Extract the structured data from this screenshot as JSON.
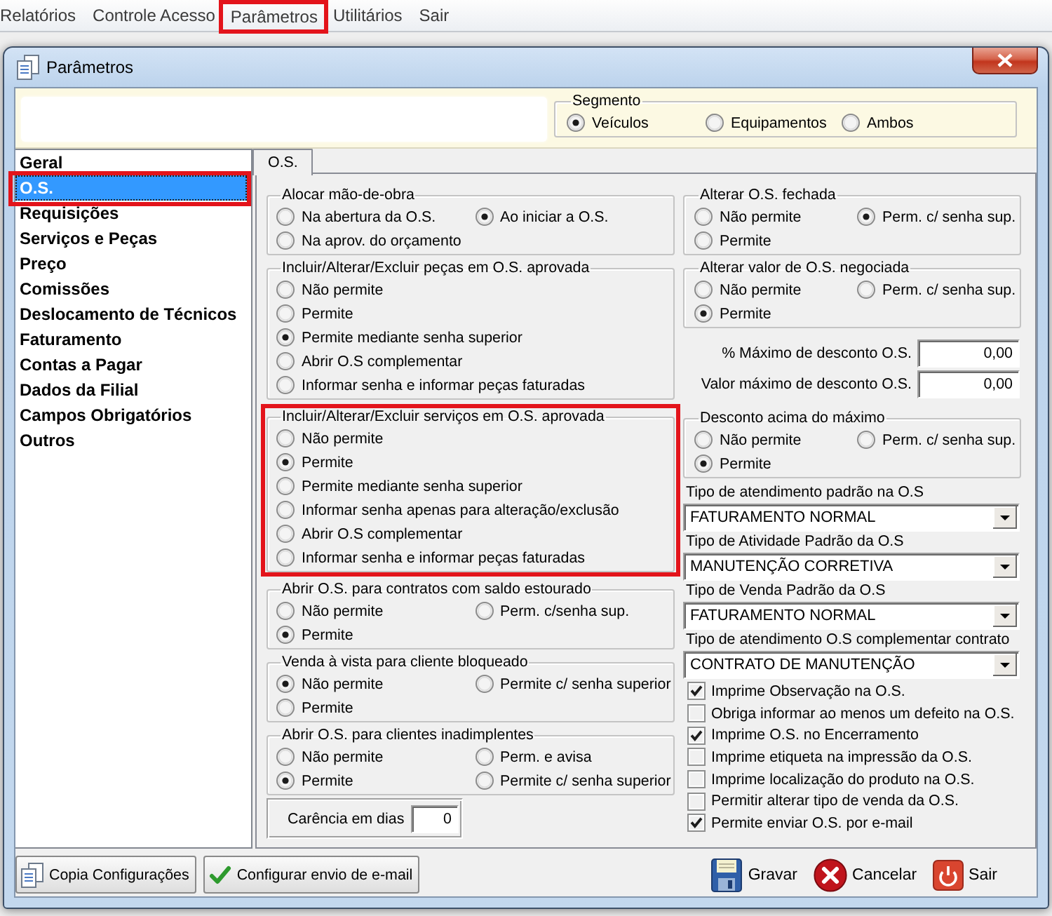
{
  "menu_bar": {
    "items": [
      {
        "label": "Relatórios",
        "highlighted": false
      },
      {
        "label": "Controle Acesso",
        "highlighted": false
      },
      {
        "label": "Parâmetros",
        "highlighted": true
      },
      {
        "label": "Utilitários",
        "highlighted": false
      },
      {
        "label": "Sair",
        "highlighted": false
      }
    ]
  },
  "window": {
    "title": "Parâmetros"
  },
  "segment": {
    "kind": "radio_row",
    "title": "Segmento",
    "options": [
      {
        "label": "Veículos",
        "selected": true
      },
      {
        "label": "Equipamentos",
        "selected": false
      },
      {
        "label": "Ambos",
        "selected": false
      }
    ]
  },
  "sidebar": {
    "items": [
      {
        "label": "Geral",
        "selected": false,
        "highlighted": false
      },
      {
        "label": "O.S.",
        "selected": true,
        "highlighted": true
      },
      {
        "label": "Requisições",
        "selected": false,
        "highlighted": false
      },
      {
        "label": "Serviços e Peças",
        "selected": false,
        "highlighted": false
      },
      {
        "label": "Preço",
        "selected": false,
        "highlighted": false
      },
      {
        "label": "Comissões",
        "selected": false,
        "highlighted": false
      },
      {
        "label": "Deslocamento de Técnicos",
        "selected": false,
        "highlighted": false
      },
      {
        "label": "Faturamento",
        "selected": false,
        "highlighted": false
      },
      {
        "label": "Contas a Pagar",
        "selected": false,
        "highlighted": false
      },
      {
        "label": "Dados da Filial",
        "selected": false,
        "highlighted": false
      },
      {
        "label": "Campos Obrigatórios",
        "selected": false,
        "highlighted": false
      },
      {
        "label": "Outros",
        "selected": false,
        "highlighted": false
      }
    ]
  },
  "tabs": [
    {
      "label": "O.S.",
      "selected": true
    }
  ],
  "left_column": [
    {
      "kind": "radio_grid",
      "title": "Alocar mão-de-obra",
      "highlighted": false,
      "options": [
        {
          "label": "Na abertura da O.S.",
          "selected": false
        },
        {
          "label": "Ao iniciar a O.S.",
          "selected": true
        },
        {
          "label": "Na aprov. do orçamento",
          "selected": false
        }
      ]
    },
    {
      "kind": "radio_list",
      "title": "Incluir/Alterar/Excluir peças em O.S. aprovada",
      "highlighted": false,
      "options": [
        {
          "label": "Não permite",
          "selected": false
        },
        {
          "label": "Permite",
          "selected": false
        },
        {
          "label": "Permite mediante senha superior",
          "selected": true
        },
        {
          "label": "Abrir O.S complementar",
          "selected": false
        },
        {
          "label": "Informar senha e informar peças faturadas",
          "selected": false
        }
      ]
    },
    {
      "kind": "radio_list",
      "title": "Incluir/Alterar/Excluir serviços em O.S. aprovada",
      "highlighted": true,
      "options": [
        {
          "label": "Não permite",
          "selected": false
        },
        {
          "label": "Permite",
          "selected": true
        },
        {
          "label": "Permite mediante senha superior",
          "selected": false
        },
        {
          "label": "Informar senha apenas para alteração/exclusão",
          "selected": false
        },
        {
          "label": "Abrir O.S complementar",
          "selected": false
        },
        {
          "label": "Informar senha e informar peças faturadas",
          "selected": false
        }
      ]
    },
    {
      "kind": "radio_grid",
      "title": "Abrir O.S. para contratos com saldo estourado",
      "highlighted": false,
      "options": [
        {
          "label": "Não permite",
          "selected": false
        },
        {
          "label": "Perm. c/senha sup.",
          "selected": false
        },
        {
          "label": "Permite",
          "selected": true
        }
      ]
    },
    {
      "kind": "radio_grid",
      "title": "Venda à vista para cliente bloqueado",
      "highlighted": false,
      "options": [
        {
          "label": "Não permite",
          "selected": true
        },
        {
          "label": "Permite c/ senha superior",
          "selected": false
        },
        {
          "label": "Permite",
          "selected": false
        }
      ]
    },
    {
      "kind": "radio_grid",
      "title": "Abrir O.S. para clientes inadimplentes",
      "highlighted": false,
      "options": [
        {
          "label": "Não permite",
          "selected": false
        },
        {
          "label": "Perm. e avisa",
          "selected": false
        },
        {
          "label": "Permite",
          "selected": true
        },
        {
          "label": "Permite c/ senha superior",
          "selected": false
        }
      ]
    },
    {
      "kind": "boxed_field",
      "label": "Carência em dias",
      "value": "0"
    }
  ],
  "right_column": [
    {
      "kind": "radio_grid",
      "title": "Alterar O.S. fechada",
      "highlighted": false,
      "options": [
        {
          "label": "Não permite",
          "selected": false
        },
        {
          "label": "Perm. c/ senha sup.",
          "selected": true
        },
        {
          "label": "Permite",
          "selected": false
        }
      ]
    },
    {
      "kind": "radio_grid",
      "title": "Alterar valor de O.S. negociada",
      "highlighted": false,
      "options": [
        {
          "label": "Não permite",
          "selected": false
        },
        {
          "label": "Perm. c/ senha sup.",
          "selected": false
        },
        {
          "label": "Permite",
          "selected": true
        }
      ]
    },
    {
      "kind": "number_field",
      "label": "% Máximo de desconto O.S.",
      "value": "0,00"
    },
    {
      "kind": "number_field",
      "label": "Valor máximo de desconto O.S.",
      "value": "0,00"
    },
    {
      "kind": "radio_grid",
      "title": "Desconto acima do máximo",
      "highlighted": false,
      "options": [
        {
          "label": "Não permite",
          "selected": false
        },
        {
          "label": "Perm. c/ senha sup.",
          "selected": false
        },
        {
          "label": "Permite",
          "selected": true
        }
      ]
    },
    {
      "kind": "dropdown",
      "label": "Tipo de atendimento padrão na O.S",
      "value": "FATURAMENTO NORMAL"
    },
    {
      "kind": "dropdown",
      "label": "Tipo de Atividade Padrão da O.S",
      "value": "MANUTENÇÃO CORRETIVA"
    },
    {
      "kind": "dropdown",
      "label": "Tipo de Venda Padrão da O.S",
      "value": "FATURAMENTO NORMAL"
    },
    {
      "kind": "dropdown",
      "label": "Tipo de atendimento O.S complementar contrato",
      "value": "CONTRATO DE MANUTENÇÃO"
    },
    {
      "kind": "checkbox",
      "label": "Imprime Observação na O.S.",
      "checked": true
    },
    {
      "kind": "checkbox",
      "label": "Obriga informar ao menos um defeito na O.S.",
      "checked": false
    },
    {
      "kind": "checkbox",
      "label": "Imprime O.S. no Encerramento",
      "checked": true
    },
    {
      "kind": "checkbox",
      "label": "Imprime etiqueta na impressão da O.S.",
      "checked": false
    },
    {
      "kind": "checkbox",
      "label": "Imprime localização do produto na O.S.",
      "checked": false
    },
    {
      "kind": "checkbox",
      "label": "Permitir alterar tipo de venda da O.S.",
      "checked": false
    },
    {
      "kind": "checkbox",
      "label": "Permite enviar O.S. por e-mail",
      "checked": true
    }
  ],
  "footer": {
    "left_buttons": [
      {
        "label": "Copia Configurações"
      },
      {
        "label": "Configurar envio de e-mail"
      }
    ],
    "right_buttons": [
      {
        "label": "Gravar"
      },
      {
        "label": "Cancelar"
      },
      {
        "label": "Sair"
      }
    ]
  }
}
